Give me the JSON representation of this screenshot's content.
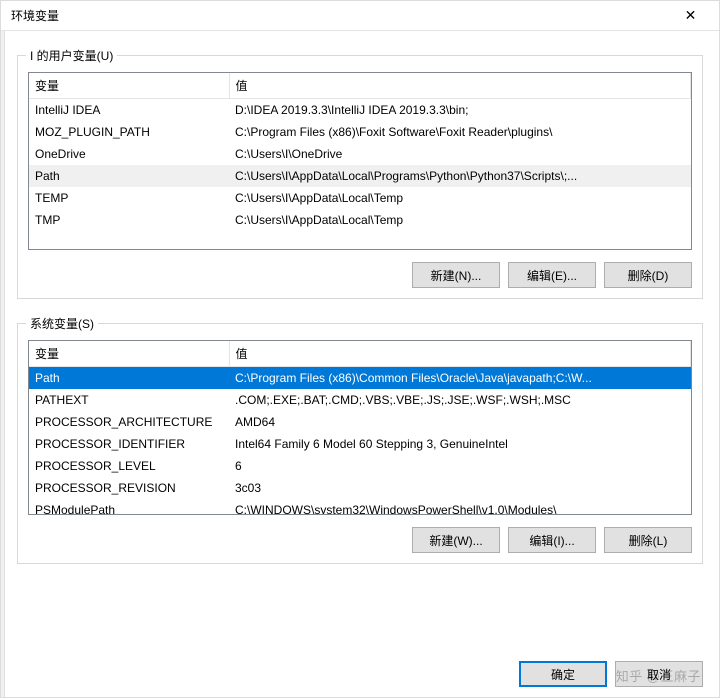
{
  "title": "环境变量",
  "close_glyph": "✕",
  "user_group_label": "I 的用户变量(U)",
  "system_group_label": "系统变量(S)",
  "columns": {
    "name": "变量",
    "value": "值"
  },
  "user_vars": [
    {
      "name": "IntelliJ IDEA",
      "value": "D:\\IDEA 2019.3.3\\IntelliJ IDEA 2019.3.3\\bin;"
    },
    {
      "name": "MOZ_PLUGIN_PATH",
      "value": "C:\\Program Files (x86)\\Foxit Software\\Foxit Reader\\plugins\\"
    },
    {
      "name": "OneDrive",
      "value": "C:\\Users\\I\\OneDrive"
    },
    {
      "name": "Path",
      "value": "C:\\Users\\I\\AppData\\Local\\Programs\\Python\\Python37\\Scripts\\;..."
    },
    {
      "name": "TEMP",
      "value": "C:\\Users\\I\\AppData\\Local\\Temp"
    },
    {
      "name": "TMP",
      "value": "C:\\Users\\I\\AppData\\Local\\Temp"
    }
  ],
  "user_selected_index": 3,
  "system_vars": [
    {
      "name": "Path",
      "value": "C:\\Program Files (x86)\\Common Files\\Oracle\\Java\\javapath;C:\\W..."
    },
    {
      "name": "PATHEXT",
      "value": ".COM;.EXE;.BAT;.CMD;.VBS;.VBE;.JS;.JSE;.WSF;.WSH;.MSC"
    },
    {
      "name": "PROCESSOR_ARCHITECTURE",
      "value": "AMD64"
    },
    {
      "name": "PROCESSOR_IDENTIFIER",
      "value": "Intel64 Family 6 Model 60 Stepping 3, GenuineIntel"
    },
    {
      "name": "PROCESSOR_LEVEL",
      "value": "6"
    },
    {
      "name": "PROCESSOR_REVISION",
      "value": "3c03"
    },
    {
      "name": "PSModulePath",
      "value": "C:\\WINDOWS\\system32\\WindowsPowerShell\\v1.0\\Modules\\"
    }
  ],
  "system_selected_index": 0,
  "buttons": {
    "user_new": "新建(N)...",
    "user_edit": "编辑(E)...",
    "user_delete": "删除(D)",
    "sys_new": "新建(W)...",
    "sys_edit": "编辑(I)...",
    "sys_delete": "删除(L)",
    "ok": "确定",
    "cancel": "取消"
  },
  "watermark": "知乎 @王麻子"
}
